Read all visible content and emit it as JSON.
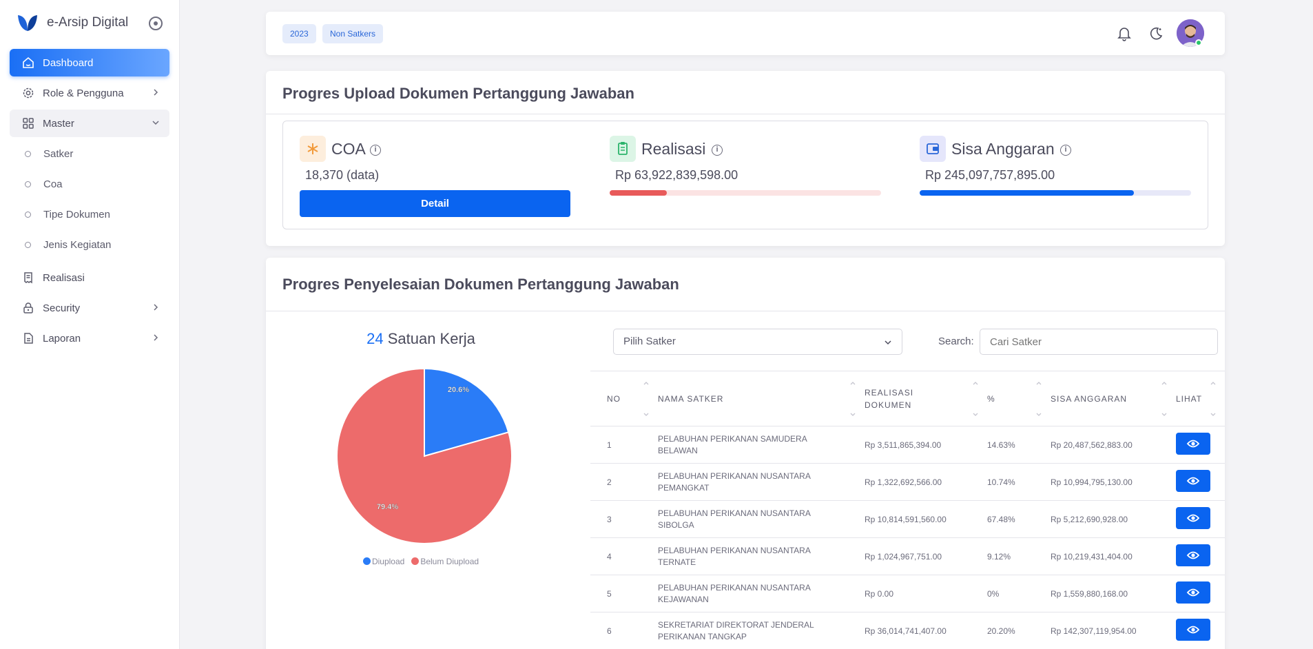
{
  "sidebar": {
    "brand": "e-Arsip Digital",
    "items": [
      {
        "label": "Dashboard",
        "icon": "home-icon"
      },
      {
        "label": "Role & Pengguna",
        "icon": "gear-icon"
      },
      {
        "label": "Master",
        "icon": "grid-icon"
      },
      {
        "label": "Realisasi",
        "icon": "receipt-icon"
      },
      {
        "label": "Security",
        "icon": "lock-icon"
      },
      {
        "label": "Laporan",
        "icon": "document-icon"
      }
    ],
    "master_sub": [
      "Satker",
      "Coa",
      "Tipe Dokumen",
      "Jenis Kegiatan"
    ]
  },
  "topbar": {
    "chips": [
      "2023",
      "Non Satkers"
    ]
  },
  "upload_card": {
    "title": "Progres Upload Dokumen Pertanggung Jawaban",
    "coa": {
      "title": "COA",
      "value": "18,370 (data)",
      "button": "Detail"
    },
    "realisasi": {
      "title": "Realisasi",
      "value": "Rp 63,922,839,598.00",
      "progress": 0.21
    },
    "sisa": {
      "title": "Sisa Anggaran",
      "value": "Rp 245,097,757,895.00",
      "progress": 0.79
    }
  },
  "progress_card": {
    "title": "Progres Penyelesaian Dokumen Pertanggung Jawaban",
    "pie_count": "24",
    "pie_label": "Satuan Kerja",
    "select_placeholder": "Pilih Satker",
    "search_label": "Search:",
    "search_placeholder": "Cari Satker",
    "columns": [
      "NO",
      "NAMA SATKER",
      "REALISASI DOKUMEN",
      "%",
      "SISA ANGGARAN",
      "LIHAT"
    ],
    "rows": [
      {
        "no": "1",
        "name": "PELABUHAN PERIKANAN SAMUDERA BELAWAN",
        "realisasi": "Rp 3,511,865,394.00",
        "pct": "14.63%",
        "sisa": "Rp 20,487,562,883.00"
      },
      {
        "no": "2",
        "name": "PELABUHAN PERIKANAN NUSANTARA PEMANGKAT",
        "realisasi": "Rp 1,322,692,566.00",
        "pct": "10.74%",
        "sisa": "Rp 10,994,795,130.00"
      },
      {
        "no": "3",
        "name": "PELABUHAN PERIKANAN NUSANTARA SIBOLGA",
        "realisasi": "Rp 10,814,591,560.00",
        "pct": "67.48%",
        "sisa": "Rp 5,212,690,928.00"
      },
      {
        "no": "4",
        "name": "PELABUHAN PERIKANAN NUSANTARA TERNATE",
        "realisasi": "Rp 1,024,967,751.00",
        "pct": "9.12%",
        "sisa": "Rp 10,219,431,404.00"
      },
      {
        "no": "5",
        "name": "PELABUHAN PERIKANAN NUSANTARA KEJAWANAN",
        "realisasi": "Rp 0.00",
        "pct": "0%",
        "sisa": "Rp 1,559,880,168.00"
      },
      {
        "no": "6",
        "name": "SEKRETARIAT DIREKTORAT JENDERAL PERIKANAN TANGKAP",
        "realisasi": "Rp 36,014,741,407.00",
        "pct": "20.20%",
        "sisa": "Rp 142,307,119,954.00"
      }
    ]
  },
  "chart_data": {
    "type": "pie",
    "labels": [
      "Diupload",
      "Belum Diupload"
    ],
    "values": [
      20.6,
      79.4
    ],
    "value_labels": [
      "20.6%",
      "79.4%"
    ],
    "colors": [
      "#2a7cf7",
      "#ed6b6b"
    ],
    "legend": "bottom"
  },
  "colors": {
    "primary": "#0a64f0",
    "danger": "#e85a5a",
    "pie_blue": "#2a7cf7",
    "pie_red": "#ed6b6b"
  }
}
